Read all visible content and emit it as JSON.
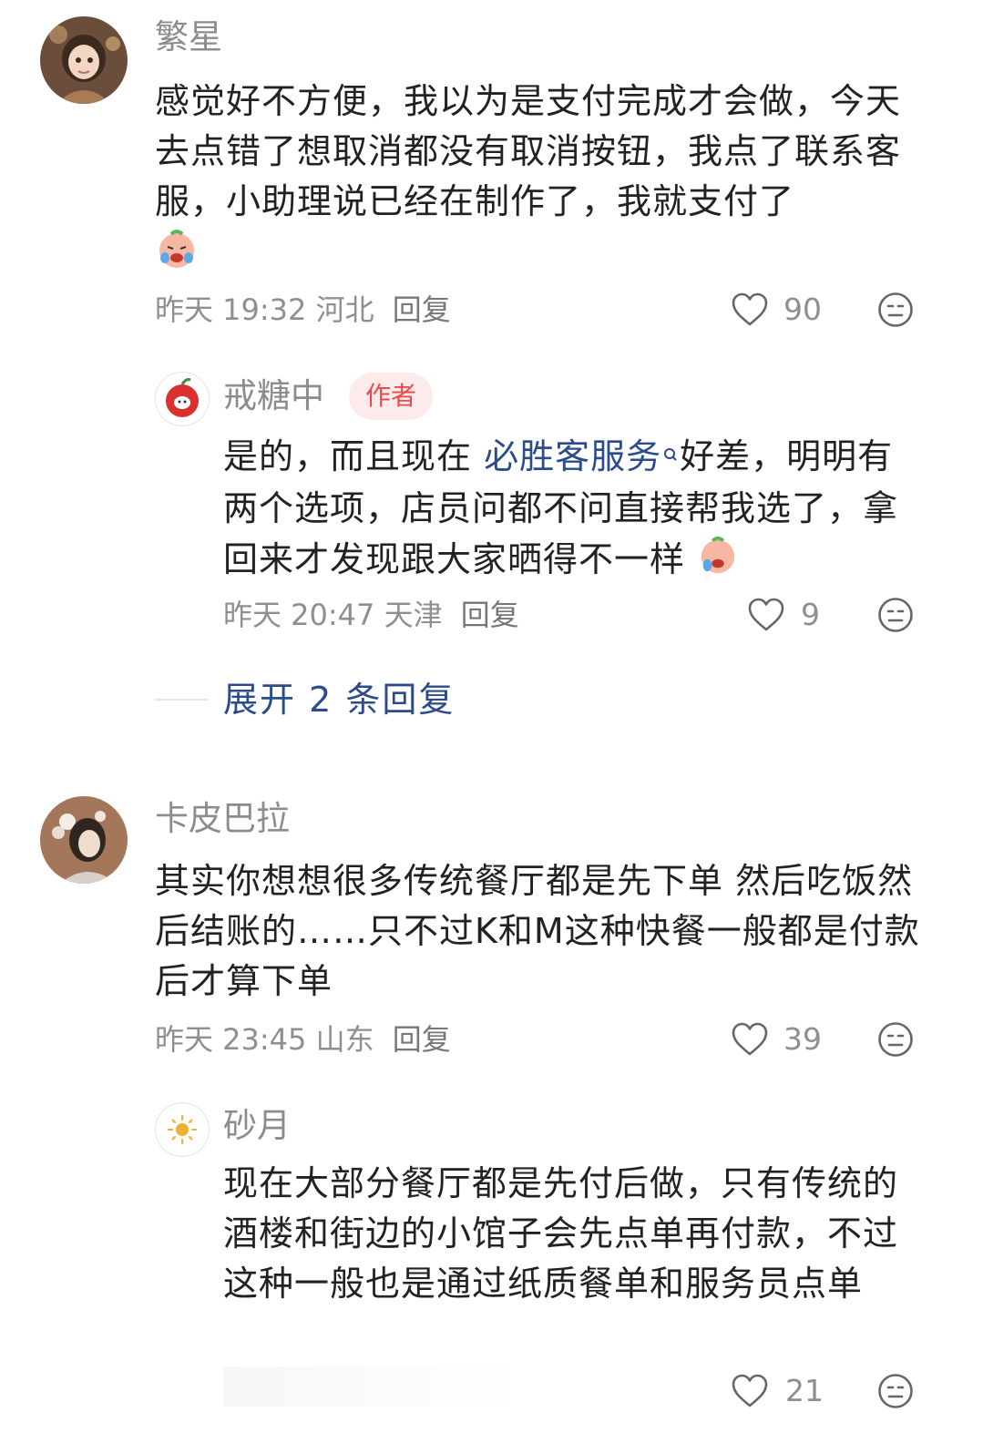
{
  "comments": [
    {
      "username": "繁星",
      "text": "感觉好不方便，我以为是支付完成才会做，今天去点错了想取消都没有取消按钮，我点了联系客服，小助理说已经在制作了，我就支付了",
      "emoji": "crying-face-emoji",
      "time": "昨天 19:32",
      "location": "河北",
      "reply_label": "回复",
      "likes": "90",
      "replies": [
        {
          "username": "戒糖中",
          "badge": "作者",
          "text_before": "是的，而且现在",
          "link_text": "必胜客服务",
          "text_after": "好差，明明有两个选项，店员问都不问直接帮我选了，拿回来才发现跟大家晒得不一样",
          "time": "昨天 20:47",
          "location": "天津",
          "reply_label": "回复",
          "likes": "9"
        }
      ],
      "expand_label": "展开 2 条回复"
    },
    {
      "username": "卡皮巴拉",
      "text": "其实你想想很多传统餐厅都是先下单 然后吃饭然后结账的……只不过K和M这种快餐一般都是付款后才算下单",
      "time": "昨天 23:45",
      "location": "山东",
      "reply_label": "回复",
      "likes": "39",
      "replies": [
        {
          "username": "砂月",
          "text": "现在大部分餐厅都是先付后做，只有传统的酒楼和街边的小馆子会先点单再付款，不过这种一般也是通过纸质餐单和服务员点单",
          "likes": "21"
        }
      ]
    }
  ],
  "colors": {
    "username": "#8c8c8c",
    "text": "#222222",
    "link": "#2b4c8c",
    "badge_bg": "#fdeaea",
    "badge_text": "#e94b4b"
  }
}
